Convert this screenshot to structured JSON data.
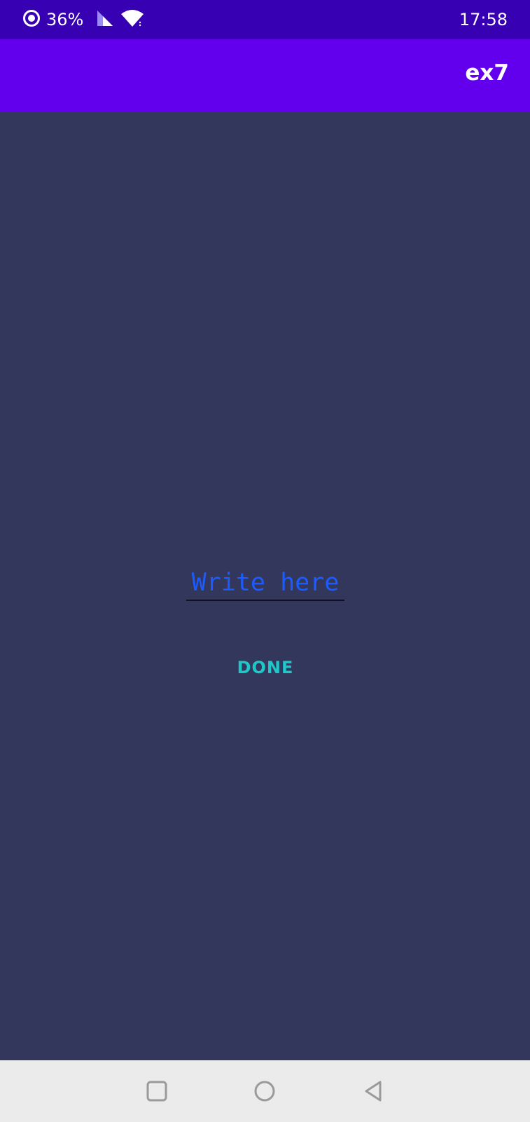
{
  "status_bar": {
    "battery_percent": "36%",
    "time": "17:58",
    "icons": [
      "data-saver-icon",
      "signal-icon",
      "wifi-icon"
    ]
  },
  "app_bar": {
    "title": "ex7"
  },
  "main": {
    "text_input": {
      "placeholder": "Write here",
      "value": ""
    },
    "done_button": {
      "label": "DONE"
    }
  },
  "nav_bar": {
    "icons": [
      "recents-square-icon",
      "home-circle-icon",
      "back-triangle-icon"
    ]
  },
  "colors": {
    "status_bar": "#3700b3",
    "app_bar": "#6200ee",
    "background": "#34375c",
    "input_text": "#1a5cff",
    "button_text": "#1ec8c8",
    "nav_bar": "#ebebec"
  }
}
